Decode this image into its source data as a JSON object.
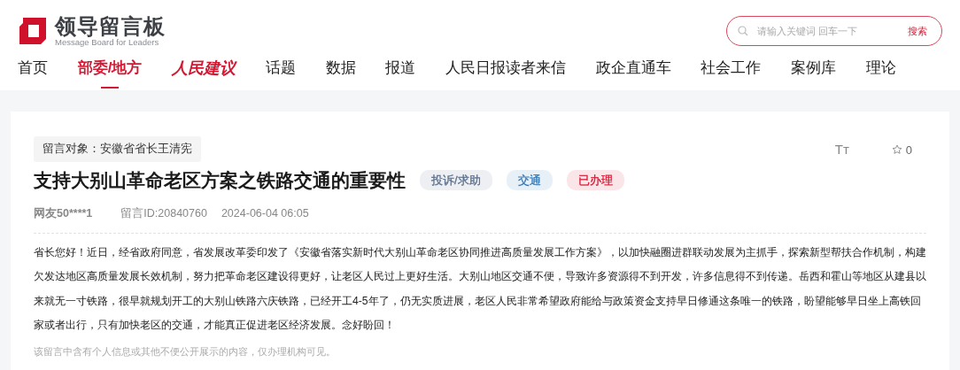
{
  "logo": {
    "title": "领导留言板",
    "subtitle": "Message Board for Leaders"
  },
  "search": {
    "placeholder": "请输入关键词 回车一下",
    "button": "搜索"
  },
  "nav": [
    {
      "label": "首页",
      "selected": false,
      "kind": "plain"
    },
    {
      "label": "部委/地方",
      "selected": true,
      "kind": "plain"
    },
    {
      "label": "人民建议",
      "selected": false,
      "kind": "brand"
    },
    {
      "label": "话题",
      "selected": false,
      "kind": "plain"
    },
    {
      "label": "数据",
      "selected": false,
      "kind": "plain"
    },
    {
      "label": "报道",
      "selected": false,
      "kind": "plain"
    },
    {
      "label": "人民日报读者来信",
      "selected": false,
      "kind": "plain"
    },
    {
      "label": "政企直通车",
      "selected": false,
      "kind": "plain"
    },
    {
      "label": "社会工作",
      "selected": false,
      "kind": "plain"
    },
    {
      "label": "案例库",
      "selected": false,
      "kind": "plain"
    },
    {
      "label": "理论",
      "selected": false,
      "kind": "plain"
    }
  ],
  "message": {
    "target": "留言对象：安徽省省长王清宪",
    "font_toggle": "Tт",
    "favorites": "0",
    "title": "支持大别山革命老区方案之铁路交通的重要性",
    "tags": [
      {
        "label": "投诉/求助",
        "color": "#5b6f8e"
      },
      {
        "label": "交通",
        "color": "#2f74b5"
      },
      {
        "label": "已办理",
        "color": "#d31833"
      }
    ],
    "author": "网友50****1",
    "message_id": "留言ID:20840760",
    "time": "2024-06-04 06:05",
    "body": "省长您好！近日，经省政府同意，省发展改革委印发了《安徽省落实新时代大别山革命老区协同推进高质量发展工作方案》，以加快融圈进群联动发展为主抓手，探索新型帮扶合作机制，构建欠发达地区高质量发展长效机制，努力把革命老区建设得更好，让老区人民过上更好生活。大别山地区交通不便，导致许多资源得不到开发，许多信息得不到传递。岳西和霍山等地区从建县以来就无一寸铁路，很早就规划开工的大别山铁路六庆铁路，已经开工4-5年了，仍无实质进展，老区人民非常希望政府能给与政策资金支持早日修通这条唯一的铁路，盼望能够早日坐上高铁回家或者出行，只有加快老区的交通，才能真正促进老区经济发展。念好盼回！",
    "privacy_note": "该留言中含有个人信息或其他不便公开展示的内容，仅办理机构可见。"
  }
}
